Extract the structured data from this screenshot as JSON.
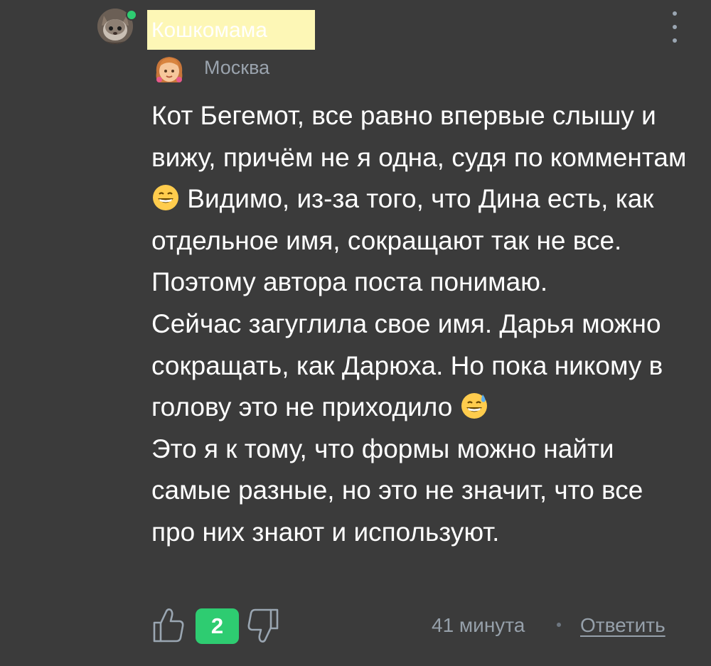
{
  "comment": {
    "author": {
      "name": "Кошкомама",
      "online": true,
      "online_color": "#2ecc71",
      "avatar_icon": "cat-avatar",
      "location_icon": "girl-emoji-icon",
      "location": "Москва"
    },
    "menu_icon": "more-vertical-icon",
    "paragraphs": [
      {
        "before": "Кот Бегемот, все равно впервые слышу и вижу, причём не я одна, судя по комментам ",
        "emoji": "grinning-face-emoji",
        "after": " Видимо, из-за того, что Дина есть, как отдельное имя, сокращают так не все. Поэтому автора поста понимаю."
      },
      {
        "before": "Сейчас загуглила свое имя. Дарья можно сокращать, как Дарюха. Но пока никому в голову это не приходило ",
        "emoji": "grinning-sweat-emoji",
        "after": ""
      },
      {
        "before": "Это я к тому, что формы можно найти самые разные, но это не значит, что все про них знают и используют.",
        "emoji": "",
        "after": ""
      }
    ],
    "footer": {
      "rating": "2",
      "rating_color": "#2ecc71",
      "thumb_up_icon": "thumb-up-icon",
      "thumb_down_icon": "thumb-down-icon",
      "time": "41 минута",
      "reply_label": "Ответить"
    }
  }
}
